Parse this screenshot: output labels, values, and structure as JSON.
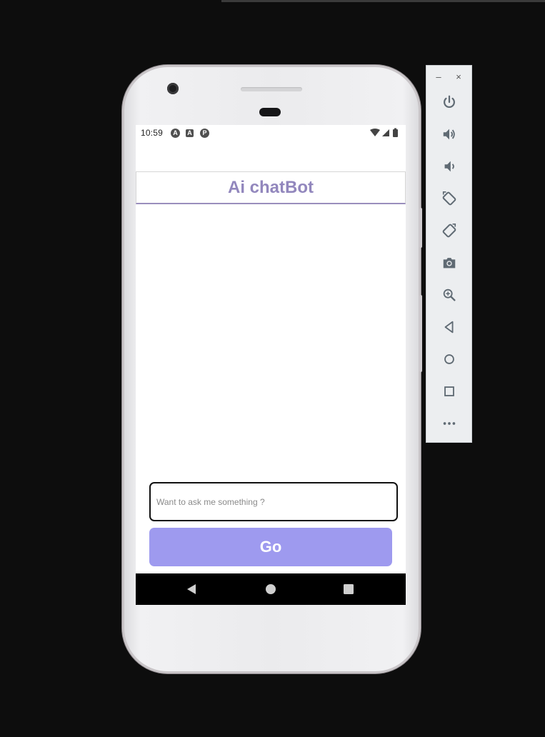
{
  "statusbar": {
    "time": "10:59",
    "notification_icons": [
      "A",
      "A",
      "P"
    ]
  },
  "app": {
    "title": "Ai chatBot",
    "input_placeholder": "Want to ask me something ?",
    "input_value": "",
    "go_label": "Go"
  },
  "colors": {
    "title": "#9287bd",
    "go_button": "#9e9aef",
    "header_underline": "#9a8fbd"
  },
  "navbar": {
    "icons": [
      "back-icon",
      "home-icon",
      "recents-icon"
    ]
  },
  "toolbar": {
    "minimize_label": "–",
    "close_label": "×",
    "icons": [
      "power-icon",
      "volume-up-icon",
      "volume-down-icon",
      "rotate-left-icon",
      "rotate-right-icon",
      "camera-icon",
      "zoom-icon",
      "back-icon",
      "home-icon",
      "overview-icon",
      "more-icon"
    ]
  }
}
